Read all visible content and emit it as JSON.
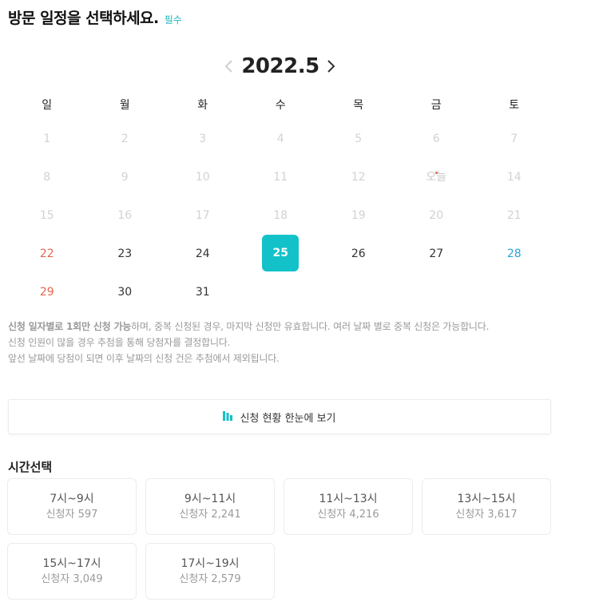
{
  "header": {
    "title": "방문 일정을 선택하세요.",
    "required": "필수"
  },
  "calendar": {
    "month_label": "2022.5",
    "weekdays": [
      "일",
      "월",
      "화",
      "수",
      "목",
      "금",
      "토"
    ],
    "today_label": "오늘",
    "days": [
      "1",
      "2",
      "3",
      "4",
      "5",
      "6",
      "7",
      "8",
      "9",
      "10",
      "11",
      "12",
      "오늘",
      "14",
      "15",
      "16",
      "17",
      "18",
      "19",
      "20",
      "21",
      "22",
      "23",
      "24",
      "25",
      "26",
      "27",
      "28",
      "29",
      "30",
      "31"
    ]
  },
  "notice": {
    "line1_bold": "신청 일자별로 1회만 신청 가능",
    "line1_rest": "하며, 중복 신청된 경우, 마지막 신청만 유효합니다. 여러 날짜 별로 중복 신청은 가능합니다.",
    "line2": "신청 인원이 많을 경우 추첨을 통해 당첨자를 결정합니다.",
    "line3": "앞선 날짜에 당첨이 되면 이후 날짜의 신청 건은 추첨에서 제외됩니다."
  },
  "status_button": {
    "label": "신청 현황 한눈에 보기"
  },
  "time_section": {
    "title": "시간선택",
    "slots": [
      {
        "time": "7시~9시",
        "count": "신청자 597"
      },
      {
        "time": "9시~11시",
        "count": "신청자 2,241"
      },
      {
        "time": "11시~13시",
        "count": "신청자 4,216"
      },
      {
        "time": "13시~15시",
        "count": "신청자 3,617"
      },
      {
        "time": "15시~17시",
        "count": "신청자 3,049"
      },
      {
        "time": "17시~19시",
        "count": "신청자 2,579"
      }
    ]
  },
  "colors": {
    "accent": "#12c2c8",
    "sunday": "#e5654f",
    "saturday": "#2aa3d6"
  }
}
